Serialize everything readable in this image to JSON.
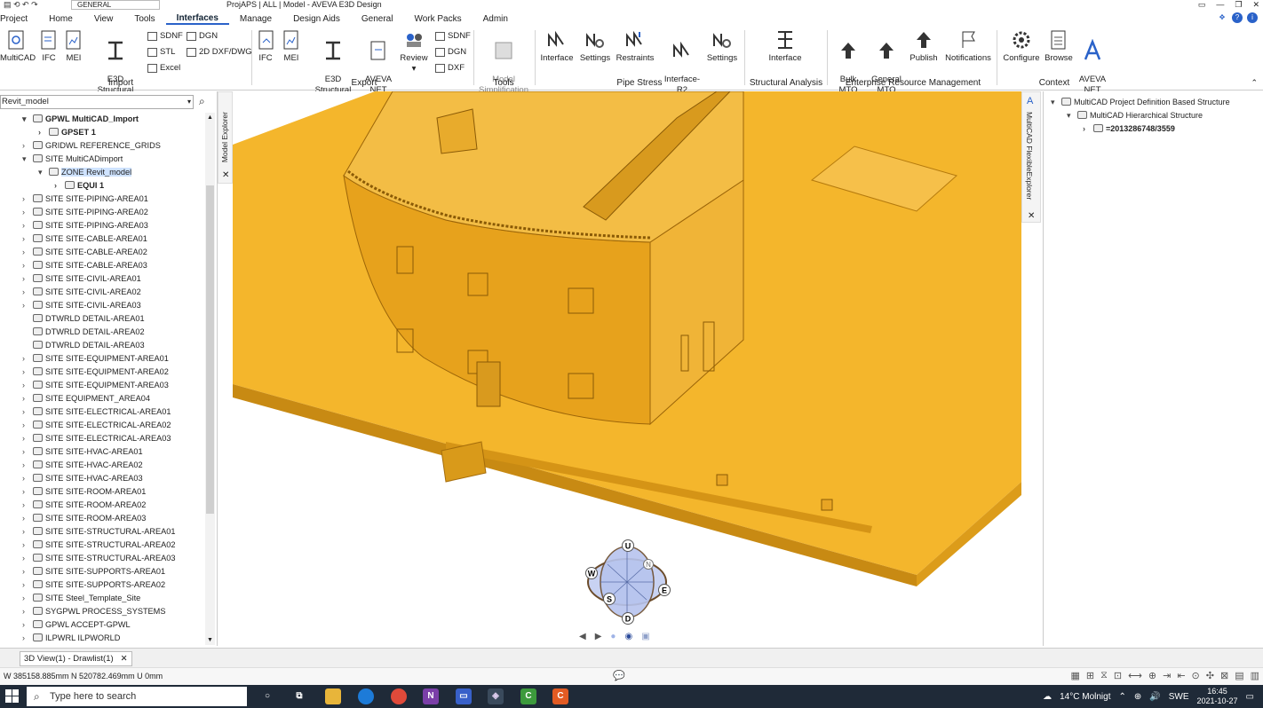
{
  "window": {
    "title": "ProjAPS | ALL | Model - AVEVA E3D Design",
    "module_selector": "GENERAL",
    "controls": [
      "▭",
      "—",
      "❐",
      "✕"
    ]
  },
  "menu": {
    "items": [
      "Project",
      "Home",
      "View",
      "Tools",
      "Interfaces",
      "Manage",
      "Design Aids",
      "General",
      "Work Packs",
      "Admin"
    ],
    "active": "Interfaces"
  },
  "ribbon": {
    "import_buttons": [
      "MultiCAD",
      "IFC",
      "MEI",
      "E3D Structural\nDesign"
    ],
    "import_small": [
      "SDNF",
      "DGN",
      "STL",
      "2D DXF/DWG",
      "Excel"
    ],
    "export_buttons": [
      "IFC",
      "MEI",
      "E3D Structural\nDesign",
      "AVEVA\nNET",
      "Review"
    ],
    "export_small": [
      "SDNF",
      "DGN",
      "DXF"
    ],
    "tools_buttons": [
      "Model\nSimplification"
    ],
    "pipe_stress_buttons": [
      "Interface",
      "Settings",
      "Restraints",
      "Interface-\nR2",
      "Settings"
    ],
    "structural_buttons": [
      "Interface"
    ],
    "erm_buttons": [
      "Bulk\nMTO",
      "General\nMTO",
      "Publish",
      "Notifications"
    ],
    "context_buttons": [
      "Configure",
      "Browse",
      "AVEVA\nNET"
    ],
    "groups": [
      "Import",
      "Export",
      "Tools",
      "Pipe Stress",
      "Structural Analysis",
      "Enterprise Resource Management",
      "Context"
    ]
  },
  "model_explorer": {
    "search_value": "Revit_model",
    "tab_label": "Model Explorer",
    "close": "✕",
    "tree": [
      {
        "label": "GPWL MultiCAD_Import",
        "level": 1,
        "arrow": "▾",
        "bold": true
      },
      {
        "label": "GPSET 1",
        "level": 2,
        "arrow": "›",
        "bold": true
      },
      {
        "label": "GRIDWL REFERENCE_GRIDS",
        "level": 1,
        "arrow": "›"
      },
      {
        "label": "SITE MultiCADimport",
        "level": 1,
        "arrow": "▾"
      },
      {
        "label": "ZONE Revit_model",
        "level": 2,
        "arrow": "▾",
        "selected": true
      },
      {
        "label": "EQUI 1",
        "level": 3,
        "arrow": "›",
        "bold": true
      },
      {
        "label": "SITE SITE-PIPING-AREA01",
        "level": 1,
        "arrow": "›"
      },
      {
        "label": "SITE SITE-PIPING-AREA02",
        "level": 1,
        "arrow": "›"
      },
      {
        "label": "SITE SITE-PIPING-AREA03",
        "level": 1,
        "arrow": "›"
      },
      {
        "label": "SITE SITE-CABLE-AREA01",
        "level": 1,
        "arrow": "›"
      },
      {
        "label": "SITE SITE-CABLE-AREA02",
        "level": 1,
        "arrow": "›"
      },
      {
        "label": "SITE SITE-CABLE-AREA03",
        "level": 1,
        "arrow": "›"
      },
      {
        "label": "SITE SITE-CIVIL-AREA01",
        "level": 1,
        "arrow": "›"
      },
      {
        "label": "SITE SITE-CIVIL-AREA02",
        "level": 1,
        "arrow": "›"
      },
      {
        "label": "SITE SITE-CIVIL-AREA03",
        "level": 1,
        "arrow": "›"
      },
      {
        "label": "DTWRLD DETAIL-AREA01",
        "level": 1,
        "arrow": ""
      },
      {
        "label": "DTWRLD DETAIL-AREA02",
        "level": 1,
        "arrow": ""
      },
      {
        "label": "DTWRLD DETAIL-AREA03",
        "level": 1,
        "arrow": ""
      },
      {
        "label": "SITE SITE-EQUIPMENT-AREA01",
        "level": 1,
        "arrow": "›"
      },
      {
        "label": "SITE SITE-EQUIPMENT-AREA02",
        "level": 1,
        "arrow": "›"
      },
      {
        "label": "SITE SITE-EQUIPMENT-AREA03",
        "level": 1,
        "arrow": "›"
      },
      {
        "label": "SITE EQUIPMENT_AREA04",
        "level": 1,
        "arrow": "›"
      },
      {
        "label": "SITE SITE-ELECTRICAL-AREA01",
        "level": 1,
        "arrow": "›"
      },
      {
        "label": "SITE SITE-ELECTRICAL-AREA02",
        "level": 1,
        "arrow": "›"
      },
      {
        "label": "SITE SITE-ELECTRICAL-AREA03",
        "level": 1,
        "arrow": "›"
      },
      {
        "label": "SITE SITE-HVAC-AREA01",
        "level": 1,
        "arrow": "›"
      },
      {
        "label": "SITE SITE-HVAC-AREA02",
        "level": 1,
        "arrow": "›"
      },
      {
        "label": "SITE SITE-HVAC-AREA03",
        "level": 1,
        "arrow": "›"
      },
      {
        "label": "SITE SITE-ROOM-AREA01",
        "level": 1,
        "arrow": "›"
      },
      {
        "label": "SITE SITE-ROOM-AREA02",
        "level": 1,
        "arrow": "›"
      },
      {
        "label": "SITE SITE-ROOM-AREA03",
        "level": 1,
        "arrow": "›"
      },
      {
        "label": "SITE SITE-STRUCTURAL-AREA01",
        "level": 1,
        "arrow": "›"
      },
      {
        "label": "SITE SITE-STRUCTURAL-AREA02",
        "level": 1,
        "arrow": "›"
      },
      {
        "label": "SITE SITE-STRUCTURAL-AREA03",
        "level": 1,
        "arrow": "›"
      },
      {
        "label": "SITE SITE-SUPPORTS-AREA01",
        "level": 1,
        "arrow": "›"
      },
      {
        "label": "SITE SITE-SUPPORTS-AREA02",
        "level": 1,
        "arrow": "›"
      },
      {
        "label": "SITE Steel_Template_Site",
        "level": 1,
        "arrow": "›"
      },
      {
        "label": "SYGPWL PROCESS_SYSTEMS",
        "level": 1,
        "arrow": "›"
      },
      {
        "label": "GPWL ACCEPT-GPWL",
        "level": 1,
        "arrow": "›"
      },
      {
        "label": "ILPWRL ILPWORLD",
        "level": 1,
        "arrow": "›"
      }
    ]
  },
  "multicad_explorer": {
    "tab_label": "MultiCAD FlexibleExplorer",
    "close": "✕",
    "tree": [
      {
        "label": "MultiCAD Project Definition Based Structure",
        "level": 0,
        "arrow": "▾"
      },
      {
        "label": "MultiCAD Hierarchical Structure",
        "level": 1,
        "arrow": "▾"
      },
      {
        "label": "=2013286748/3559",
        "level": 2,
        "arrow": "›",
        "bold": true
      }
    ]
  },
  "view_cube": {
    "labels": [
      "U",
      "N",
      "W",
      "E",
      "S",
      "D"
    ]
  },
  "view_nav": [
    "◀",
    "▶",
    "●",
    "◉",
    "▣"
  ],
  "document_tab": {
    "label": "3D View(1) - Drawlist(1)",
    "close": "✕"
  },
  "status": {
    "coordinates": "W 385158.885mm N 520782.469mm U 0mm",
    "message_icon": "💬"
  },
  "taskbar": {
    "search_placeholder": "Type here to search",
    "weather": "14°C Molnigt",
    "language": "SWE",
    "time": "16:45",
    "date": "2021-10-27"
  },
  "colors": {
    "accent": "#2a62c9",
    "model": "#f2b632",
    "taskbar": "#1f2a38"
  }
}
